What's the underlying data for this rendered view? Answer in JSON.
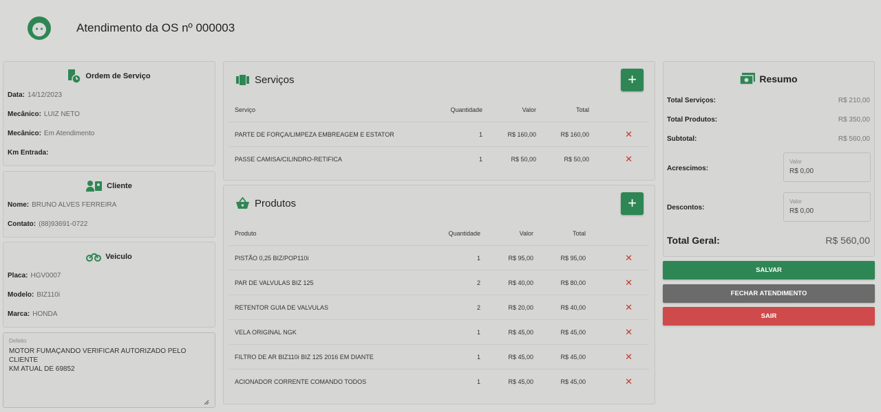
{
  "header": {
    "title": "Atendimento da OS nº 000003"
  },
  "ordem": {
    "title": "Ordem de Serviço",
    "fields": [
      {
        "label": "Data:",
        "value": "14/12/2023"
      },
      {
        "label": "Mecânico:",
        "value": "LUIZ NETO"
      },
      {
        "label": "Mecânico:",
        "value": "Em Atendimento"
      },
      {
        "label": "Km Entrada:",
        "value": ""
      }
    ]
  },
  "cliente": {
    "title": "Cliente",
    "fields": [
      {
        "label": "Nome:",
        "value": "BRUNO ALVES FERREIRA"
      },
      {
        "label": "Contato:",
        "value": "(88)93691-0722"
      }
    ]
  },
  "veiculo": {
    "title": "Veiculo",
    "fields": [
      {
        "label": "Placa:",
        "value": "HGV0007"
      },
      {
        "label": "Modelo:",
        "value": "BIZ110i"
      },
      {
        "label": "Marca:",
        "value": "HONDA"
      }
    ]
  },
  "defeito": {
    "label": "Defeito",
    "value": "MOTOR FUMAÇANDO VERIFICAR AUTORIZADO PELO CLIENTE\nKM ATUAL DE 69852"
  },
  "servicos": {
    "title": "Serviços",
    "add_label": "+",
    "headers": {
      "item": "Serviço",
      "qtd": "Quantidade",
      "valor": "Valor",
      "total": "Total"
    },
    "rows": [
      {
        "item": "PARTE DE FORÇA/LIMPEZA EMBREAGEM E ESTATOR",
        "qtd": "1",
        "valor": "R$ 160,00",
        "total": "R$ 160,00",
        "del": "✕"
      },
      {
        "item": "PASSE CAMISA/CILINDRO-RETIFICA",
        "qtd": "1",
        "valor": "R$ 50,00",
        "total": "R$ 50,00",
        "del": "✕"
      }
    ]
  },
  "produtos": {
    "title": "Produtos",
    "add_label": "+",
    "headers": {
      "item": "Produto",
      "qtd": "Quantidade",
      "valor": "Valor",
      "total": "Total"
    },
    "rows": [
      {
        "item": "PISTÃO 0,25 BIZ/POP110i",
        "qtd": "1",
        "valor": "R$ 95,00",
        "total": "R$ 95,00",
        "del": "✕"
      },
      {
        "item": "PAR DE VALVULAS BIZ 125",
        "qtd": "2",
        "valor": "R$ 40,00",
        "total": "R$ 80,00",
        "del": "✕"
      },
      {
        "item": "RETENTOR GUIA DE VALVULAS",
        "qtd": "2",
        "valor": "R$ 20,00",
        "total": "R$ 40,00",
        "del": "✕"
      },
      {
        "item": "VELA ORIGINAL NGK",
        "qtd": "1",
        "valor": "R$ 45,00",
        "total": "R$ 45,00",
        "del": "✕"
      },
      {
        "item": "FILTRO DE AR BIZ110i BIZ 125 2016 EM DIANTE",
        "qtd": "1",
        "valor": "R$ 45,00",
        "total": "R$ 45,00",
        "del": "✕"
      },
      {
        "item": "ACIONADOR CORRENTE COMANDO TODOS",
        "qtd": "1",
        "valor": "R$ 45,00",
        "total": "R$ 45,00",
        "del": "✕"
      }
    ]
  },
  "resumo": {
    "title": "Resumo",
    "total_servicos_label": "Total Serviços:",
    "total_servicos": "R$ 210,00",
    "total_produtos_label": "Total Produtos:",
    "total_produtos": "R$ 350,00",
    "subtotal_label": "Subtotal:",
    "subtotal": "R$ 560,00",
    "acrescimos_label": "Acrescimos:",
    "acrescimos_field_label": "Valor",
    "acrescimos_value": "R$ 0,00",
    "descontos_label": "Descontos:",
    "descontos_field_label": "Valor",
    "descontos_value": "R$ 0,00",
    "total_geral_label": "Total Geral:",
    "total_geral": "R$ 560,00"
  },
  "actions": {
    "salvar": "SALVAR",
    "fechar": "FECHAR ATENDIMENTO",
    "sair": "SAIR"
  },
  "colors": {
    "accent": "#2e8654",
    "fechar": "#6b6b6b",
    "sair": "#cf4a4a",
    "delete": "#c0392b"
  }
}
